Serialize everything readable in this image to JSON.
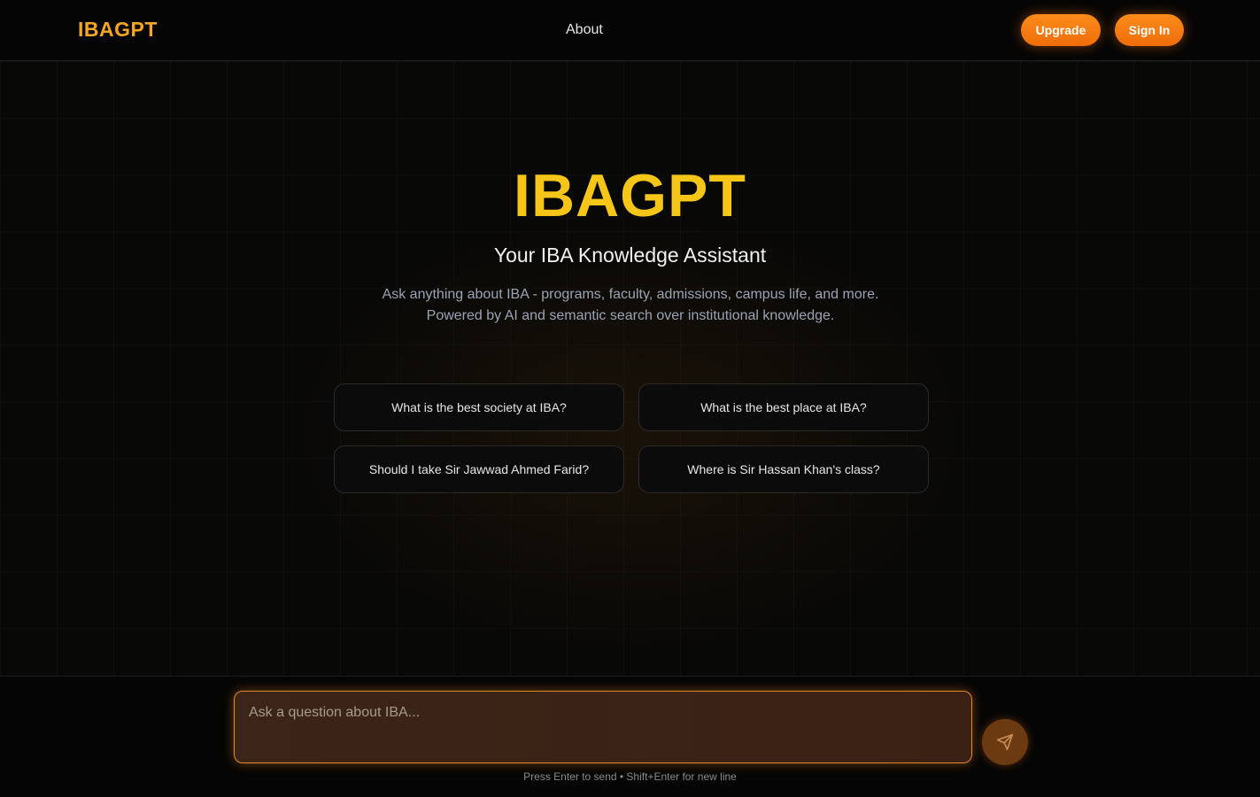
{
  "header": {
    "brand": "IBAGPT",
    "nav_about": "About",
    "upgrade_label": "Upgrade",
    "signin_label": "Sign In"
  },
  "hero": {
    "title": "IBAGPT",
    "subtitle": "Your IBA Knowledge Assistant",
    "description": "Ask anything about IBA - programs, faculty, admissions, campus life, and more. Powered by AI and semantic search over institutional knowledge."
  },
  "suggestions": [
    "What is the best society at IBA?",
    "What is the best place at IBA?",
    "Should I take Sir Jawwad Ahmed Farid?",
    "Where is Sir Hassan Khan's class?"
  ],
  "composer": {
    "placeholder": "Ask a question about IBA...",
    "value": "",
    "hint": "Press Enter to send • Shift+Enter for new line",
    "send_icon": "send-icon"
  },
  "colors": {
    "brand": "#f5a623",
    "hero_title": "#f5c518",
    "accent": "#f07a10"
  }
}
